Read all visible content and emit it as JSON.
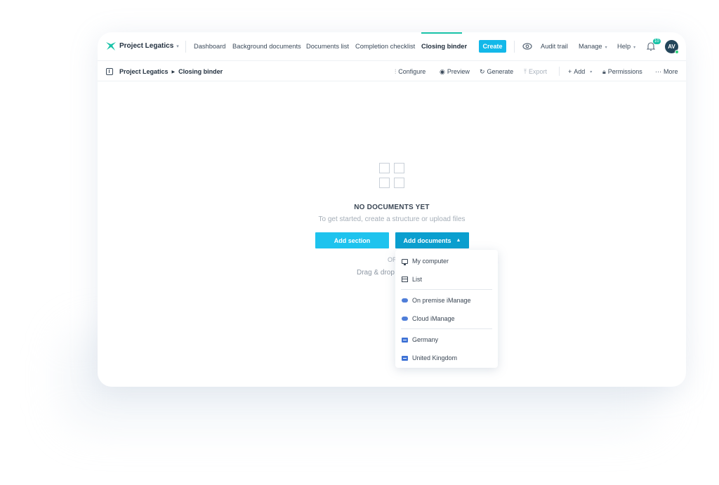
{
  "nav": {
    "project_name": "Project Legatics",
    "links": [
      "Dashboard",
      "Background documents",
      "Documents list",
      "Completion checklist",
      "Closing binder"
    ],
    "create_label": "Create",
    "audit_trail": "Audit trail",
    "manage": "Manage",
    "help": "Help",
    "notification_count": "10",
    "avatar_initials": "AV"
  },
  "breadcrumb": {
    "project": "Project Legatics",
    "page": "Closing binder"
  },
  "toolbar": {
    "configure": "Configure",
    "preview": "Preview",
    "generate": "Generate",
    "export": "Export",
    "add": "Add",
    "permissions": "Permissions",
    "more": "More"
  },
  "empty_state": {
    "title": "NO DOCUMENTS YET",
    "subtitle": "To get started, create a structure or upload files",
    "add_section": "Add section",
    "add_documents": "Add documents",
    "or": "OR",
    "drag_text": "Drag & drop"
  },
  "dropdown": {
    "items": [
      "My computer",
      "List",
      "On premise iManage",
      "Cloud iManage",
      "Germany",
      "United Kingdom"
    ]
  },
  "colors": {
    "accent": "#13b8e9",
    "accent_dark": "#0a9fcf",
    "active_tab": "#19c3a8"
  }
}
